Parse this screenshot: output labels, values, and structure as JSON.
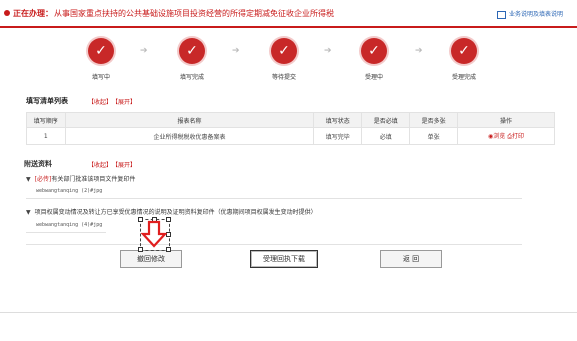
{
  "header": {
    "label": "正在办理：",
    "description": "从事国家重点扶持的公共基础设施项目投资经营的所得定期减免征收企业所得税",
    "help_link": "业务说明及填表说明"
  },
  "steps": [
    {
      "label": "填写中"
    },
    {
      "label": "填写完成"
    },
    {
      "label": "等待提交"
    },
    {
      "label": "受理中"
    },
    {
      "label": "受理完成"
    }
  ],
  "list_section": {
    "title": "填写清单列表",
    "collapse": "【收起】",
    "expand": "【展开】",
    "columns": [
      "填写顺序",
      "报表名称",
      "填写状态",
      "是否必填",
      "是否多张",
      "操作"
    ],
    "rows": [
      {
        "order": "1",
        "name": "企业所得税税收优惠备案表",
        "status": "填写完毕",
        "required": "必填",
        "multi": "单张",
        "op_view": "浏览",
        "op_print": "打印"
      }
    ]
  },
  "attach_section": {
    "title": "附送资料",
    "collapse": "【收起】",
    "expand": "【展开】",
    "items": [
      {
        "required_tag": "[必传]",
        "title": "有关部门批准该项目文件复印件",
        "file": "webwangtanqing (2)#jpg"
      },
      {
        "required_tag": "",
        "title": "项目权属变动情况及转让方已享受优惠情况的说明及证明资料复印件（优惠期间项目权属发生变动时提供）",
        "file": "webwangtanqing (4)#jpg"
      }
    ]
  },
  "buttons": {
    "modify": "撤回修改",
    "download": "受理回执下载",
    "back": "返 回"
  },
  "colors": {
    "accent": "#c81b1b",
    "step": "#c82828",
    "link": "#2c67b5"
  }
}
